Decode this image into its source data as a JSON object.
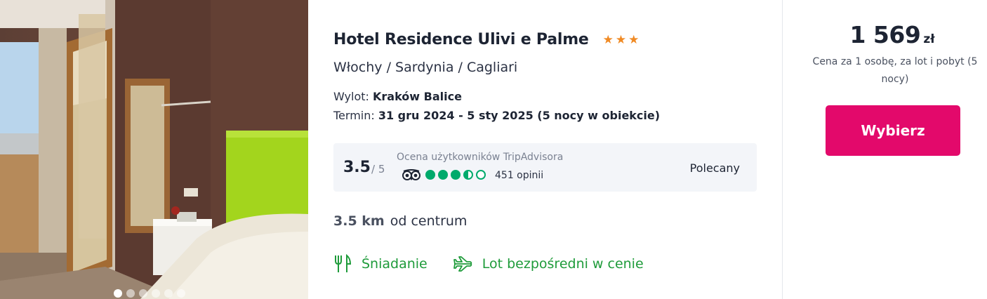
{
  "hotel": {
    "name": "Hotel Residence Ulivi e Palme",
    "stars": 3,
    "star_color": "#f08a24",
    "location": "Włochy / Sardynia / Cagliari"
  },
  "flight": {
    "departure_label": "Wylot: ",
    "departure_value": "Kraków Balice",
    "term_label": "Termin: ",
    "term_value": "31 gru 2024 - 5 sty 2025 (5 nocy w obiekcie)"
  },
  "tripadvisor": {
    "score": "3.5",
    "max": "/ 5",
    "label": "Ocena użytkowników TripAdvisora",
    "bubbles_rating": 3.5,
    "bubble_color": "#00aa6c",
    "reviews": "451 opinii",
    "recommendation": "Polecany",
    "icon": "tripadvisor-owl-icon"
  },
  "distance": {
    "value": "3.5 km",
    "label": "od centrum"
  },
  "features": [
    {
      "icon": "fork-knife-icon",
      "label": "Śniadanie"
    },
    {
      "icon": "plane-icon",
      "label": "Lot bezpośredni w cenie"
    }
  ],
  "feature_color": "#1e9b3a",
  "price": {
    "value": "1 569",
    "currency": "zł",
    "note": "Cena za 1 osobę, za lot i pobyt (5 nocy)"
  },
  "cta": {
    "label": "Wybierz",
    "color": "#e3096b"
  },
  "gallery": {
    "slide_count": 6,
    "active_slide": 1
  }
}
